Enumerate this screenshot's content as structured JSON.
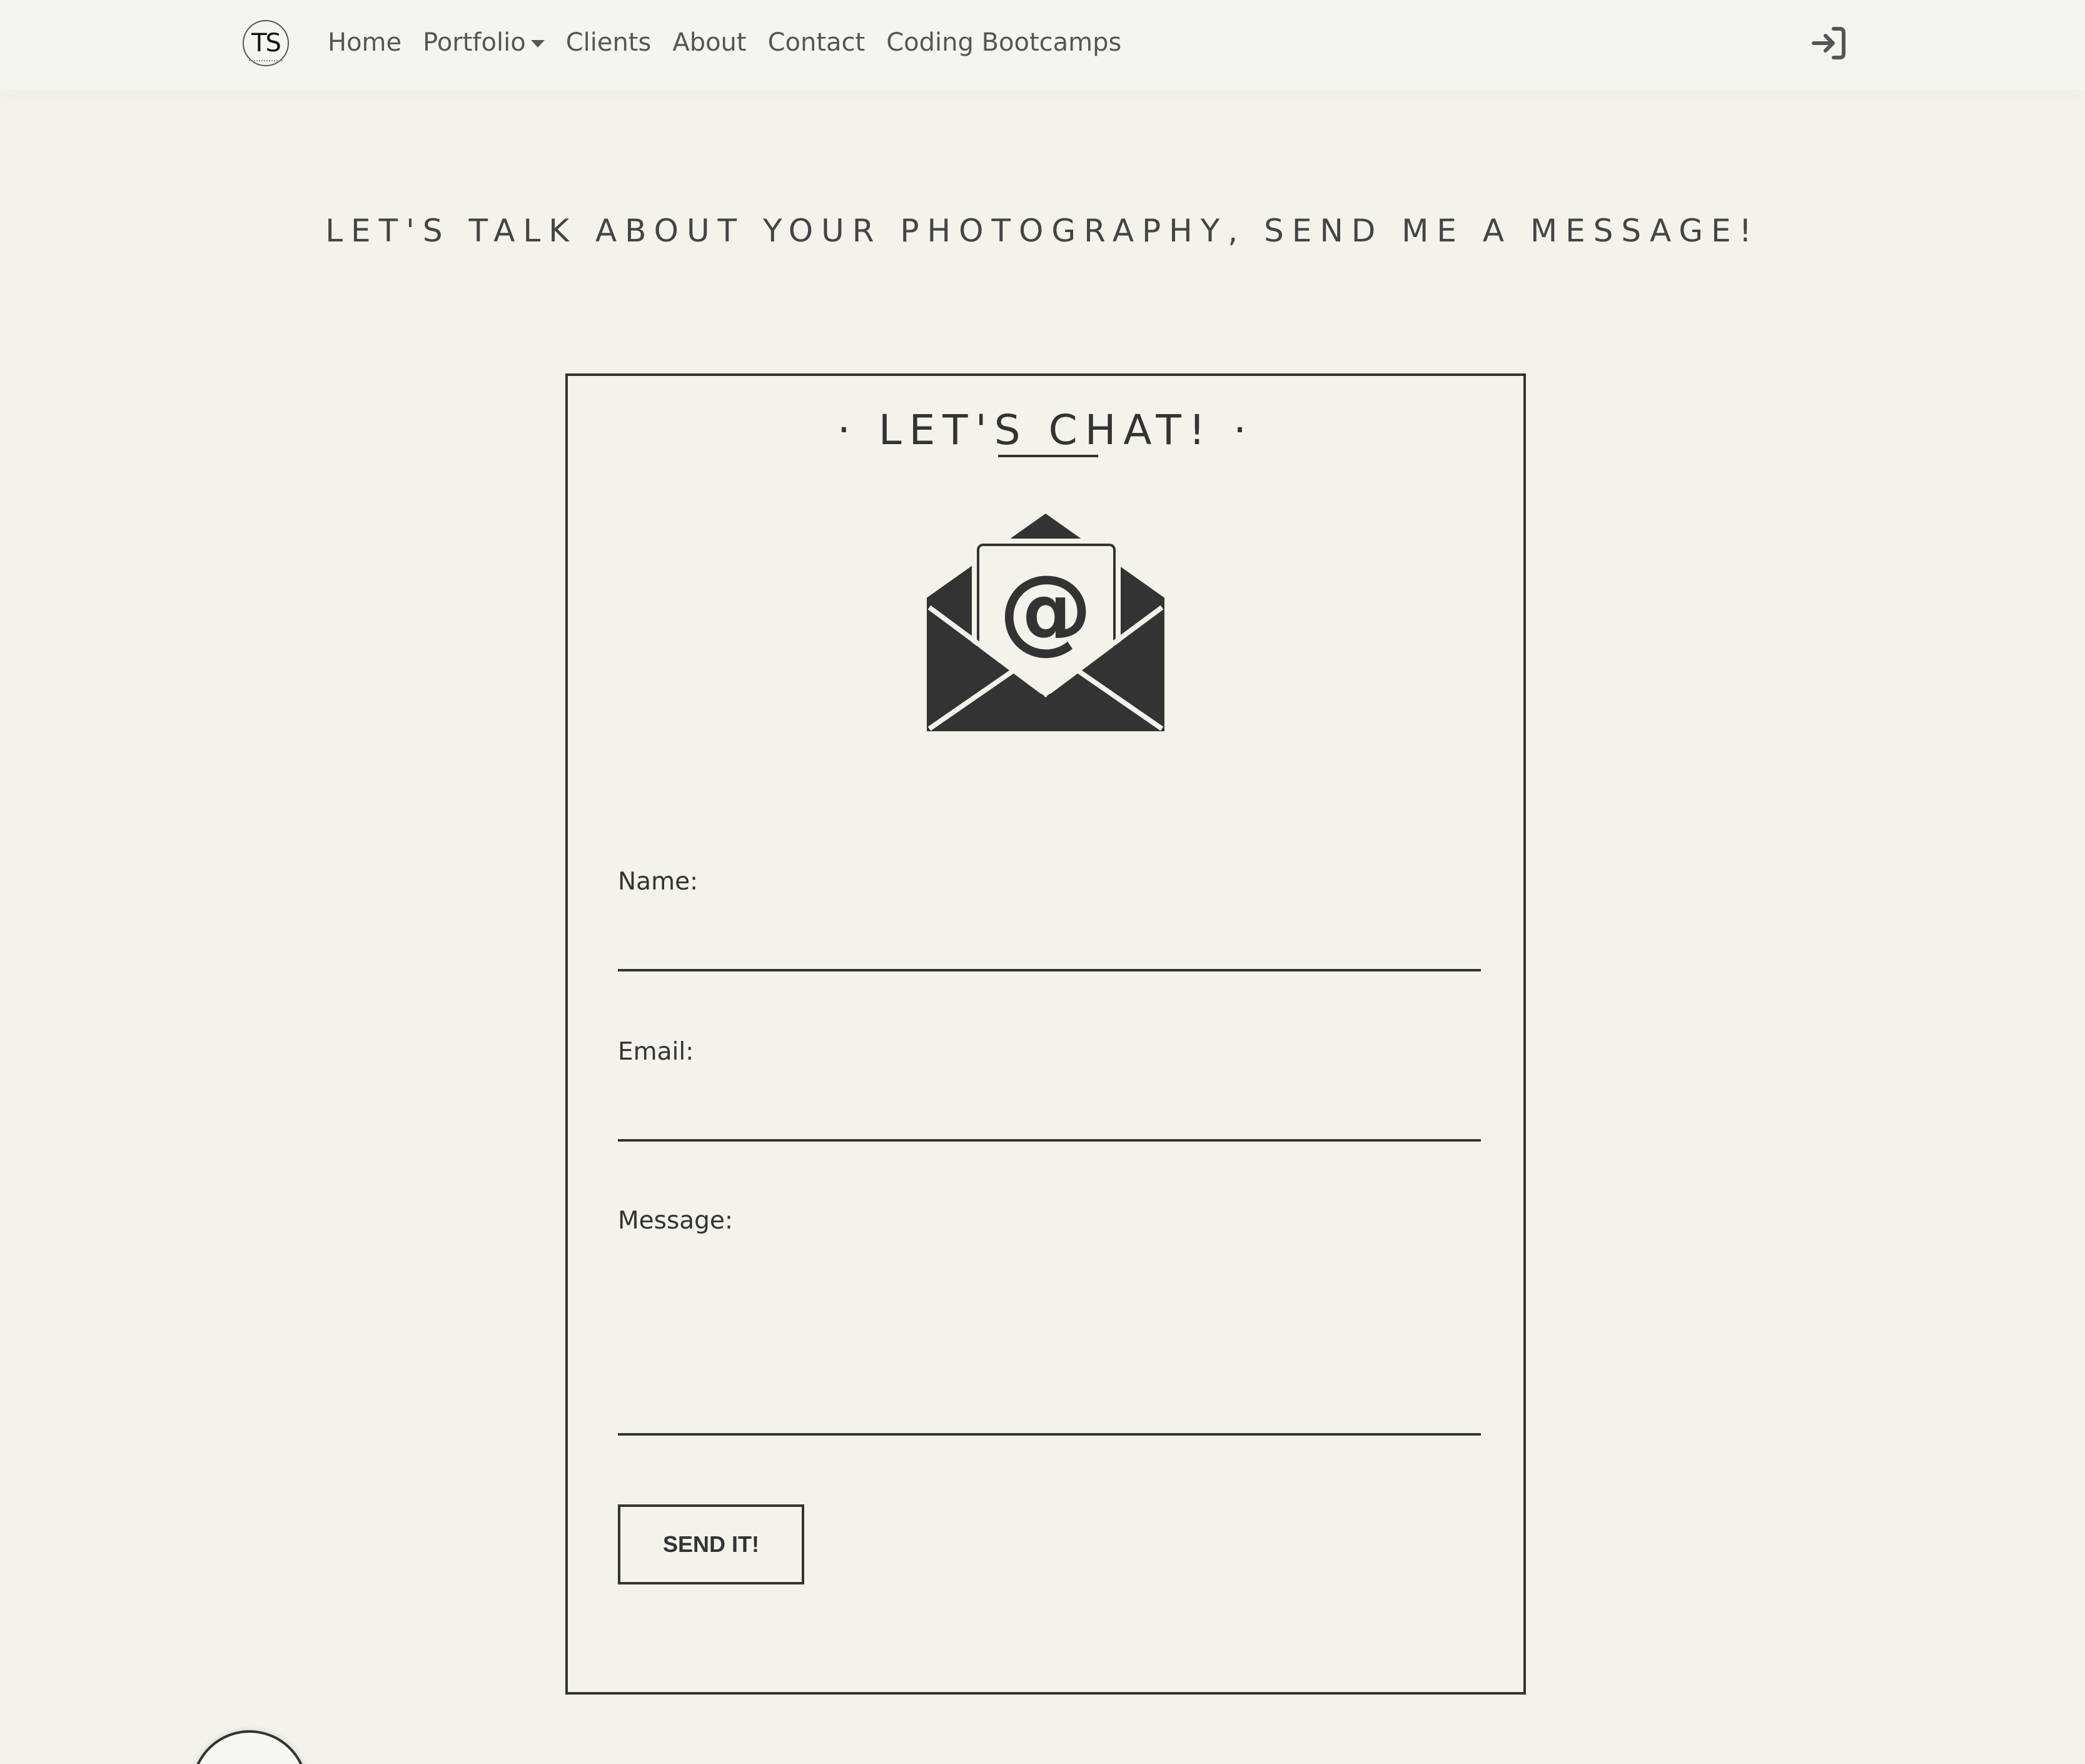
{
  "nav": {
    "logo_text": "TS",
    "links": [
      {
        "label": "Home"
      },
      {
        "label": "Portfolio"
      },
      {
        "label": "Clients"
      },
      {
        "label": "About"
      },
      {
        "label": "Contact"
      },
      {
        "label": "Coding Bootcamps"
      }
    ],
    "login_icon": "sign-in-icon"
  },
  "headline": "LET'S TALK ABOUT YOUR PHOTOGRAPHY, SEND ME A MESSAGE!",
  "card": {
    "title": "· LET'S CHAT! ·",
    "envelope_icon": "envelope-at-icon",
    "fields": {
      "name_label": "Name:",
      "name_value": "",
      "email_label": "Email:",
      "email_value": "",
      "message_label": "Message:",
      "message_value": ""
    },
    "send_label": "SEND IT!"
  },
  "colors": {
    "background": "#f3f3ec",
    "ink": "#333333",
    "nav_text": "#555555"
  }
}
